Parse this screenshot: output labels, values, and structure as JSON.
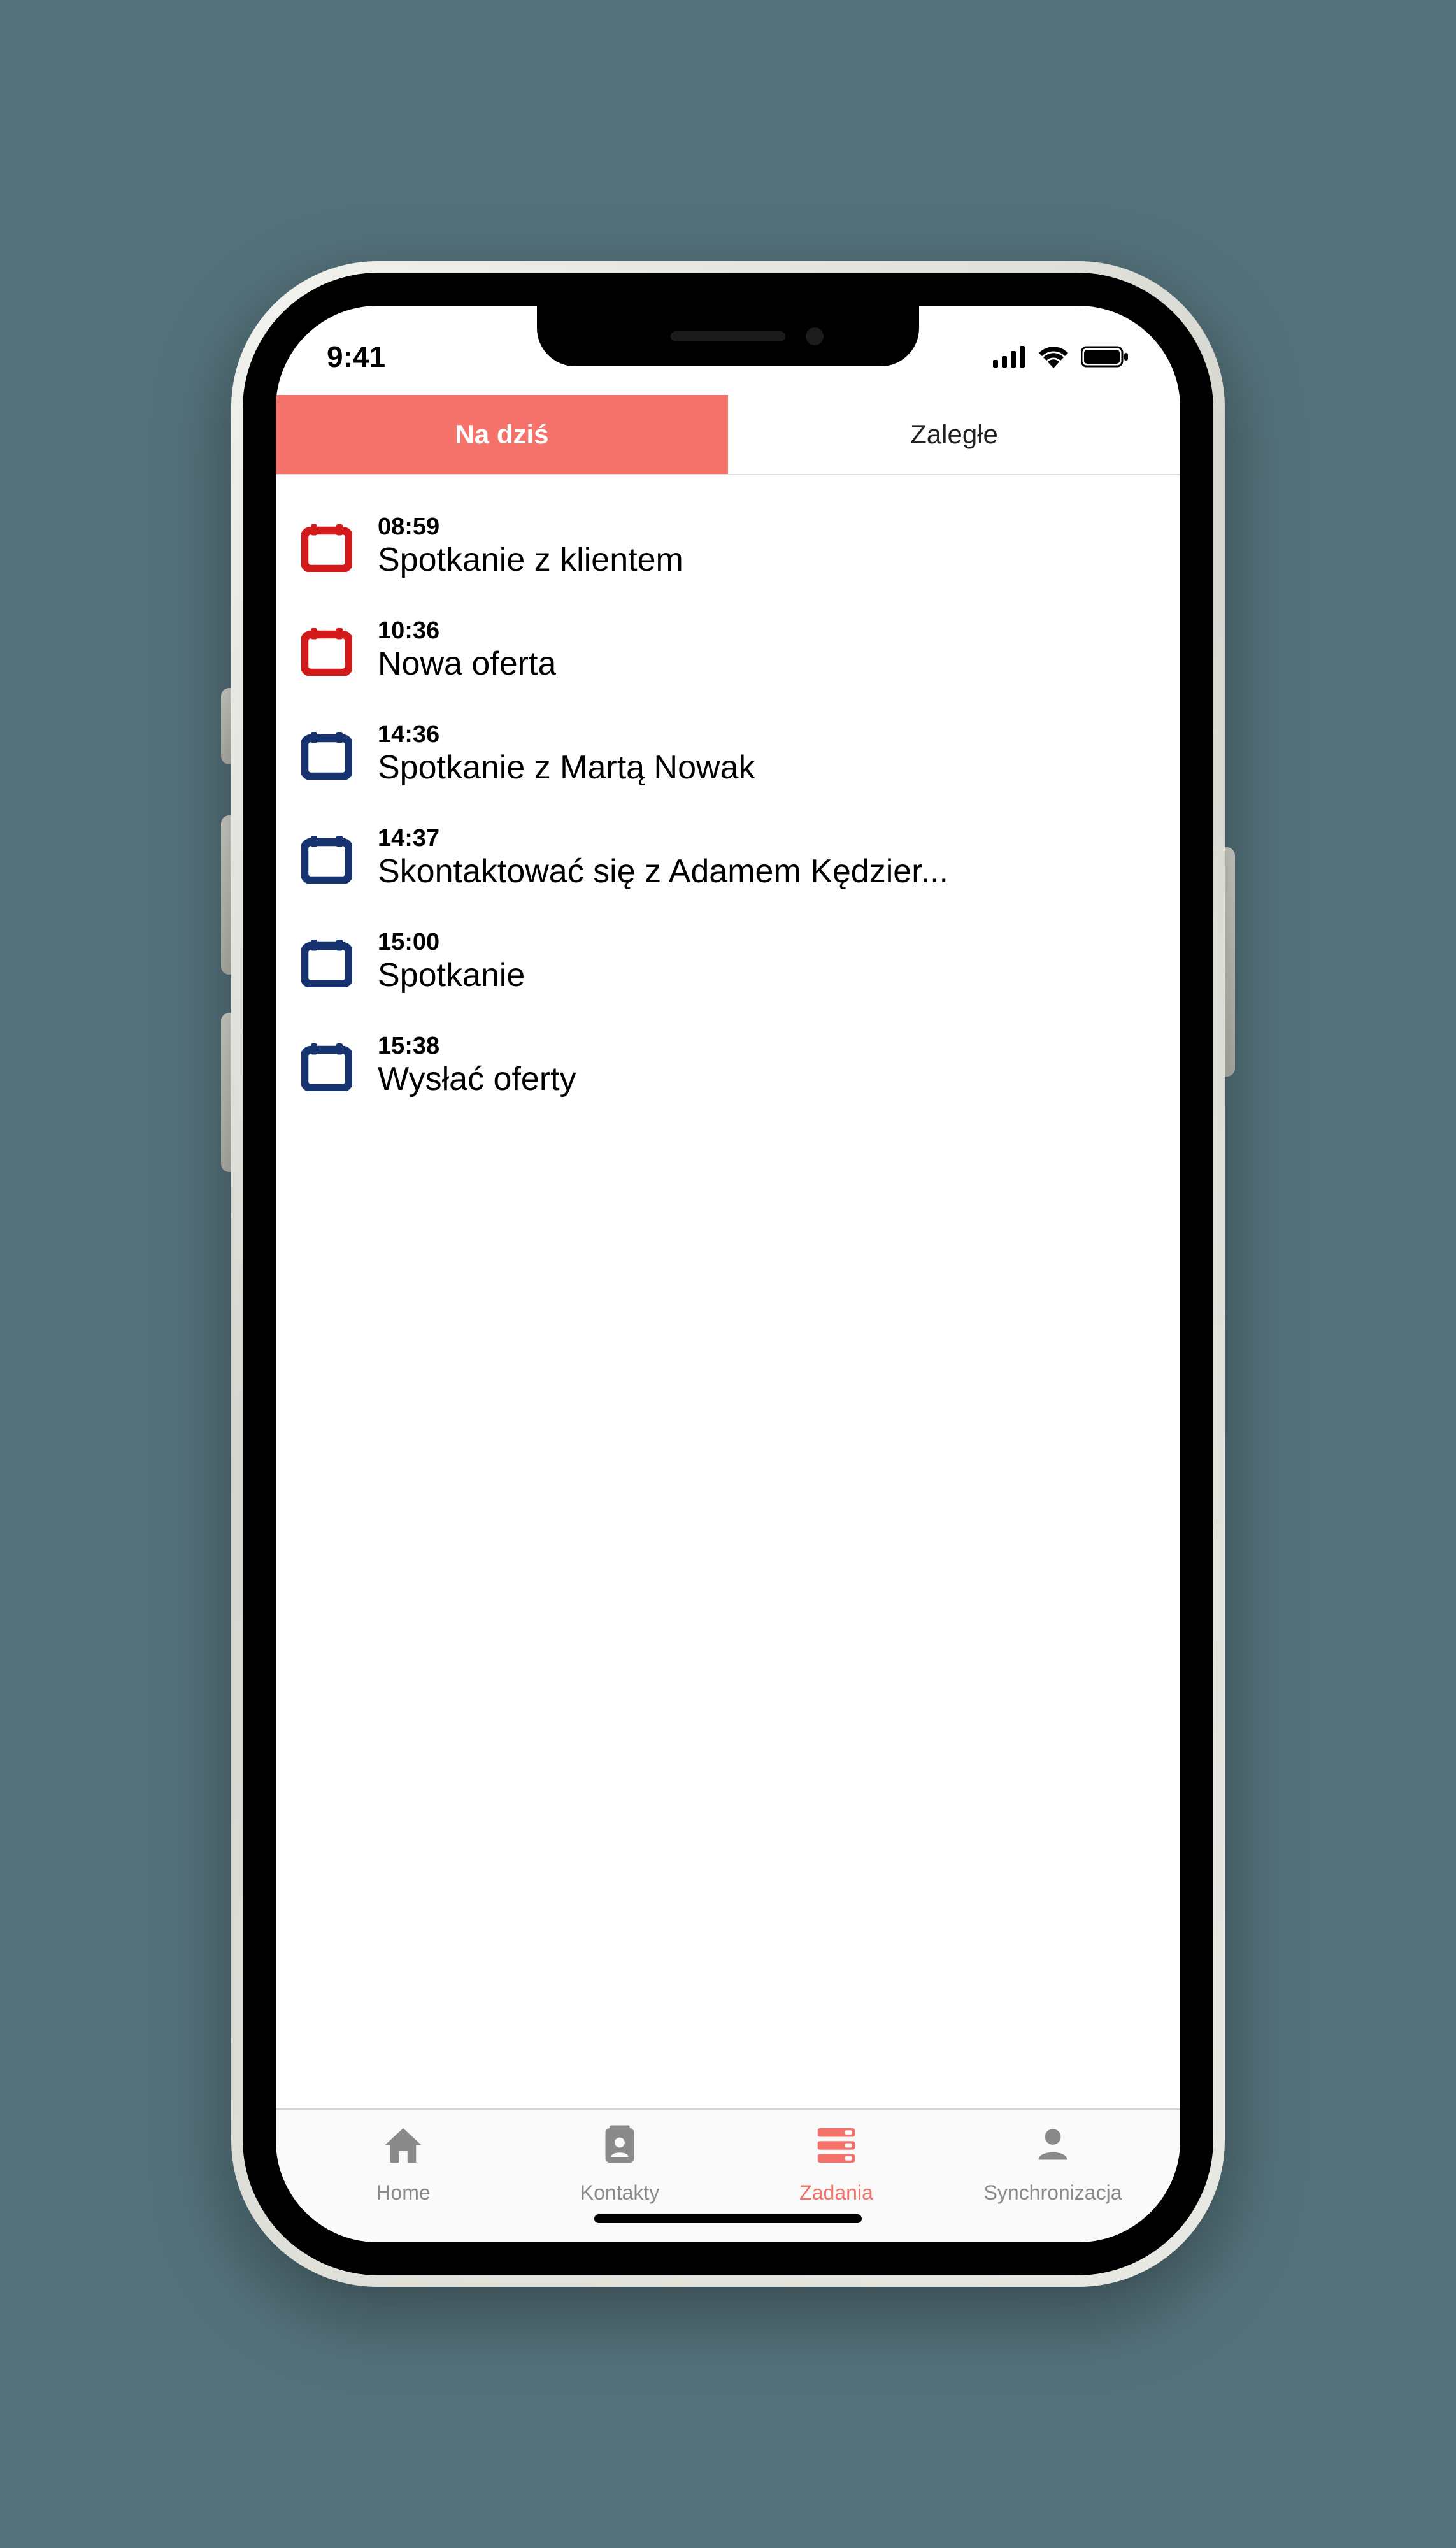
{
  "status": {
    "time": "9:41"
  },
  "segmented": {
    "tabs": [
      {
        "label": "Na dziś",
        "active": true
      },
      {
        "label": "Zaległe",
        "active": false
      }
    ]
  },
  "tasks": [
    {
      "time": "08:59",
      "title": "Spotkanie z klientem",
      "color": "red"
    },
    {
      "time": "10:36",
      "title": "Nowa oferta",
      "color": "red"
    },
    {
      "time": "14:36",
      "title": "Spotkanie z Martą Nowak",
      "color": "navy"
    },
    {
      "time": "14:37",
      "title": "Skontaktować się z Adamem Kędzier...",
      "color": "navy"
    },
    {
      "time": "15:00",
      "title": "Spotkanie",
      "color": "navy"
    },
    {
      "time": "15:38",
      "title": "Wysłać oferty",
      "color": "navy"
    }
  ],
  "colors": {
    "red": "#d11a19",
    "navy": "#16336f",
    "accent": "#f5726a",
    "muted": "#8a8a8a"
  },
  "tabbar": {
    "items": [
      {
        "label": "Home",
        "icon": "home",
        "active": false
      },
      {
        "label": "Kontakty",
        "icon": "contacts",
        "active": false
      },
      {
        "label": "Zadania",
        "icon": "tasks",
        "active": true
      },
      {
        "label": "Synchronizacja",
        "icon": "sync",
        "active": false
      }
    ]
  }
}
